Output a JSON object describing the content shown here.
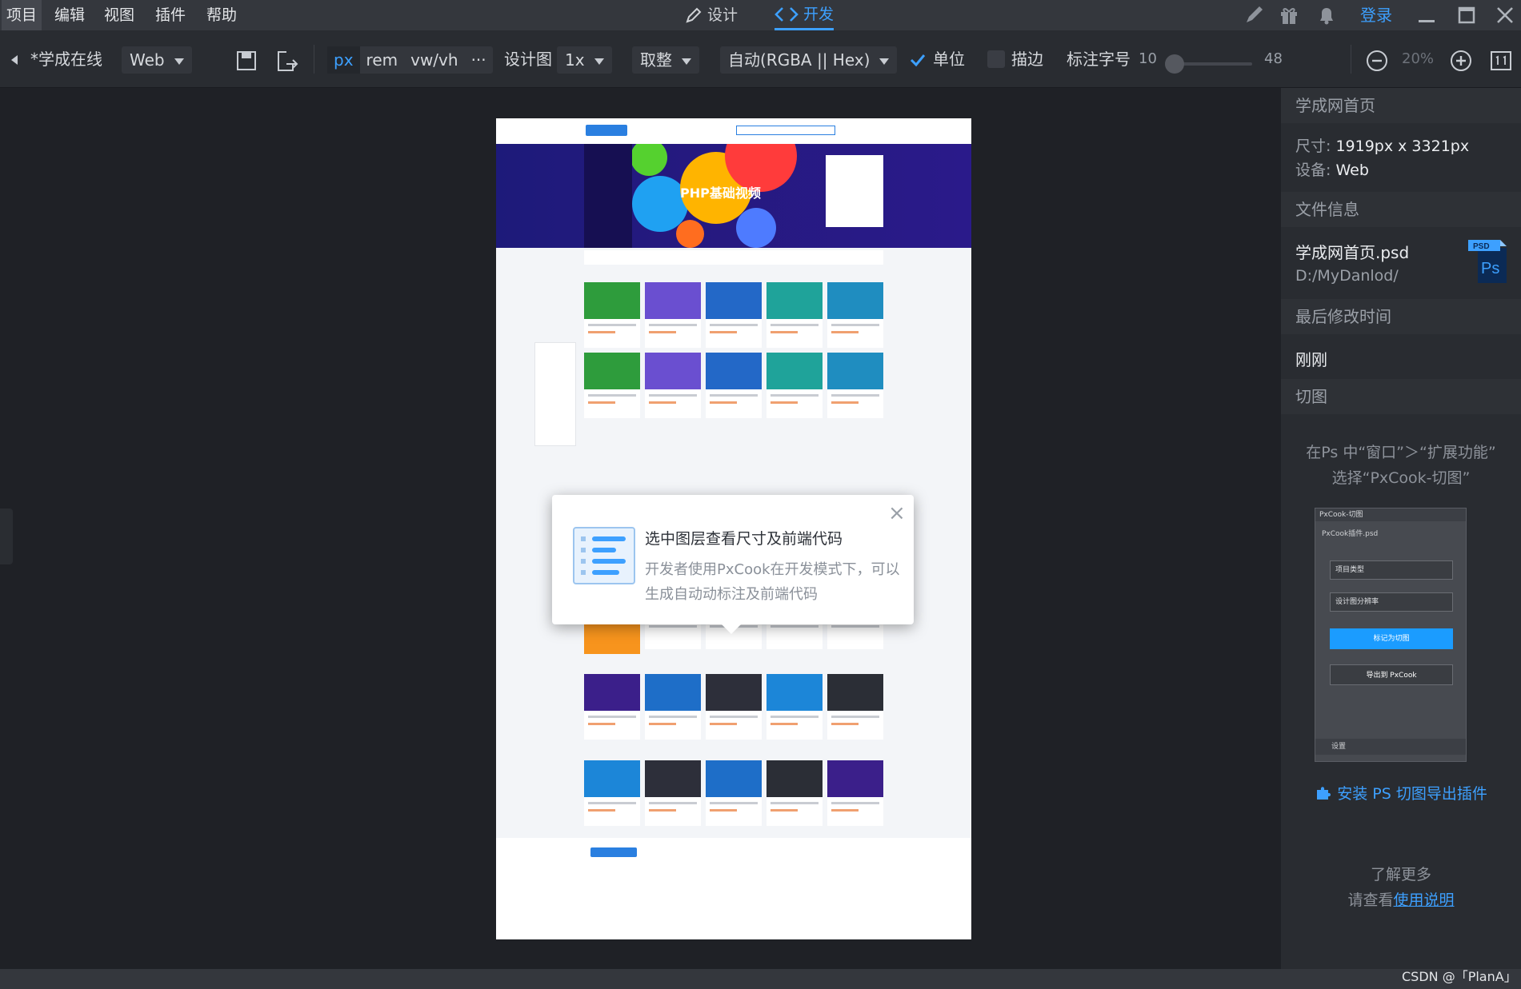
{
  "menubar": {
    "items": [
      "项目",
      "编辑",
      "视图",
      "插件",
      "帮助"
    ],
    "modes": [
      {
        "label": "设计",
        "active": false
      },
      {
        "label": "开发",
        "active": true
      }
    ],
    "login": "登录",
    "icons": [
      "pen-icon",
      "gift-icon",
      "bell-icon",
      "minimize-icon",
      "maximize-icon",
      "close-icon"
    ]
  },
  "toolbar": {
    "project_name": "*学成在线",
    "platform": "Web",
    "units": [
      "px",
      "rem",
      "vw/vh",
      "···"
    ],
    "active_unit": "px",
    "design_label": "设计图",
    "design_scale": "1x",
    "rounding": "取整",
    "color_format": "自动(RGBA || Hex)",
    "unit_checkbox": "单位",
    "unit_checked": true,
    "stroke_checkbox": "描边",
    "stroke_checked": false,
    "font_label": "标注字号",
    "font_min": "10",
    "font_max": "48",
    "zoom": "20%"
  },
  "tooltip": {
    "title": "选中图层查看尺寸及前端代码",
    "body": "开发者使用PxCook在开发模式下，可以生成自动动标注及前端代码",
    "close": "×"
  },
  "artboard": {
    "banner_text": "PHP基础视频"
  },
  "panel": {
    "page_section": "学成网首页",
    "size_label": "尺寸:",
    "size_value": "1919px x 3321px",
    "device_label": "设备:",
    "device_value": "Web",
    "file_section": "文件信息",
    "file_name": "学成网首页.psd",
    "file_path": "D:/MyDanlod/",
    "modified_section": "最后修改时间",
    "modified_value": "刚刚",
    "slice_section": "切图",
    "slice_hint_1": "在Ps 中“窗口”＞“扩展功能”",
    "slice_hint_2": "选择“PxCook-切图”",
    "plugin_preview": {
      "title": "PxCook-切图",
      "file": "PxCook插件.psd",
      "select_1": "项目类型",
      "select_2": "设计图分辨率",
      "mark_button": "标记为切图",
      "export_button": "导出到 PxCook",
      "settings": "设置"
    },
    "install_link": "安装 PS 切图导出插件",
    "learn_more": "了解更多",
    "see_prefix": "请查看",
    "manual_link": "使用说明"
  },
  "watermark": "CSDN @「PlanA」",
  "colors": {
    "accent": "#3da0ff",
    "background": "#1f2126",
    "panel": "#292c31"
  }
}
